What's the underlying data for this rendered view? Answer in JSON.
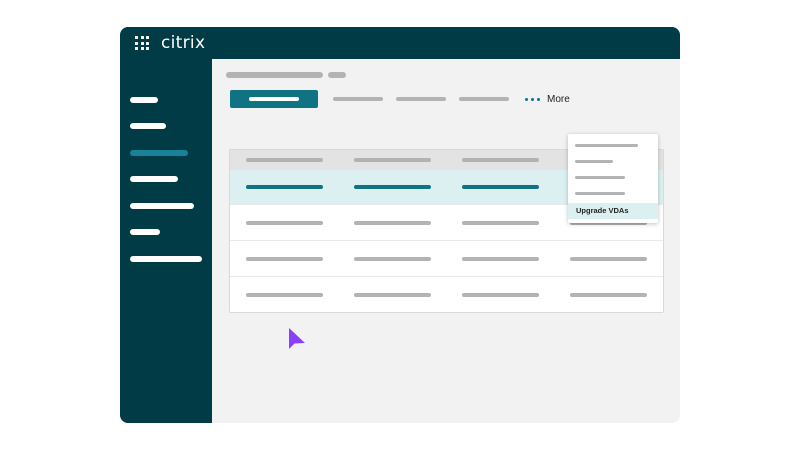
{
  "app": {
    "logo_text": "citrix",
    "brand_color": "#003b46",
    "accent_color": "#0f7384"
  },
  "toolbar": {
    "more_label": "More"
  },
  "dropdown": {
    "highlighted_item_label": "Upgrade VDAs"
  },
  "icons": {
    "apps": "grid-nine-dots-icon",
    "more": "horizontal-ellipsis-icon",
    "cursor": "mouse-pointer-icon"
  },
  "cursor_color": "#8a3ffc"
}
